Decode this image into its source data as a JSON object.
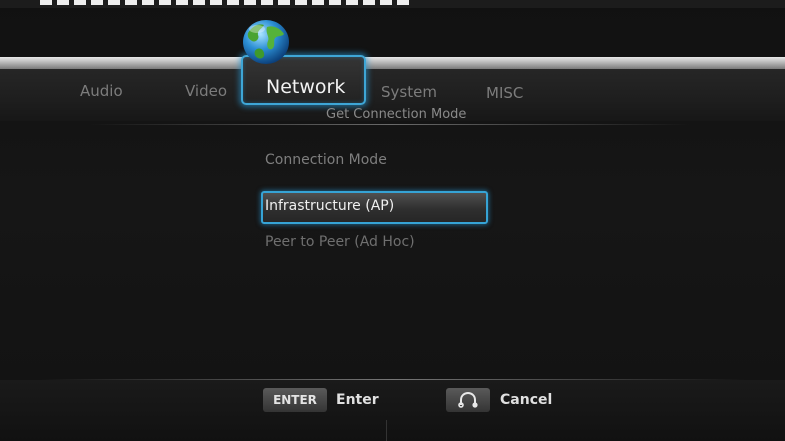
{
  "tabs": {
    "audio": "Audio",
    "video": "Video",
    "network": "Network",
    "system": "System",
    "misc": "MISC"
  },
  "page": {
    "subtitle": "Get Connection Mode",
    "field_label": "Connection Mode"
  },
  "options": [
    {
      "label": "Infrastructure (AP)",
      "selected": true
    },
    {
      "label": "Peer to Peer (Ad Hoc)",
      "selected": false
    }
  ],
  "footer": {
    "enter_key": "ENTER",
    "enter_label": "Enter",
    "cancel_label": "Cancel",
    "cancel_icon": "return-icon"
  },
  "colors": {
    "accent": "#3ea6d6",
    "active_text": "#f2f2f2",
    "inactive_text": "#7c7c7c"
  }
}
